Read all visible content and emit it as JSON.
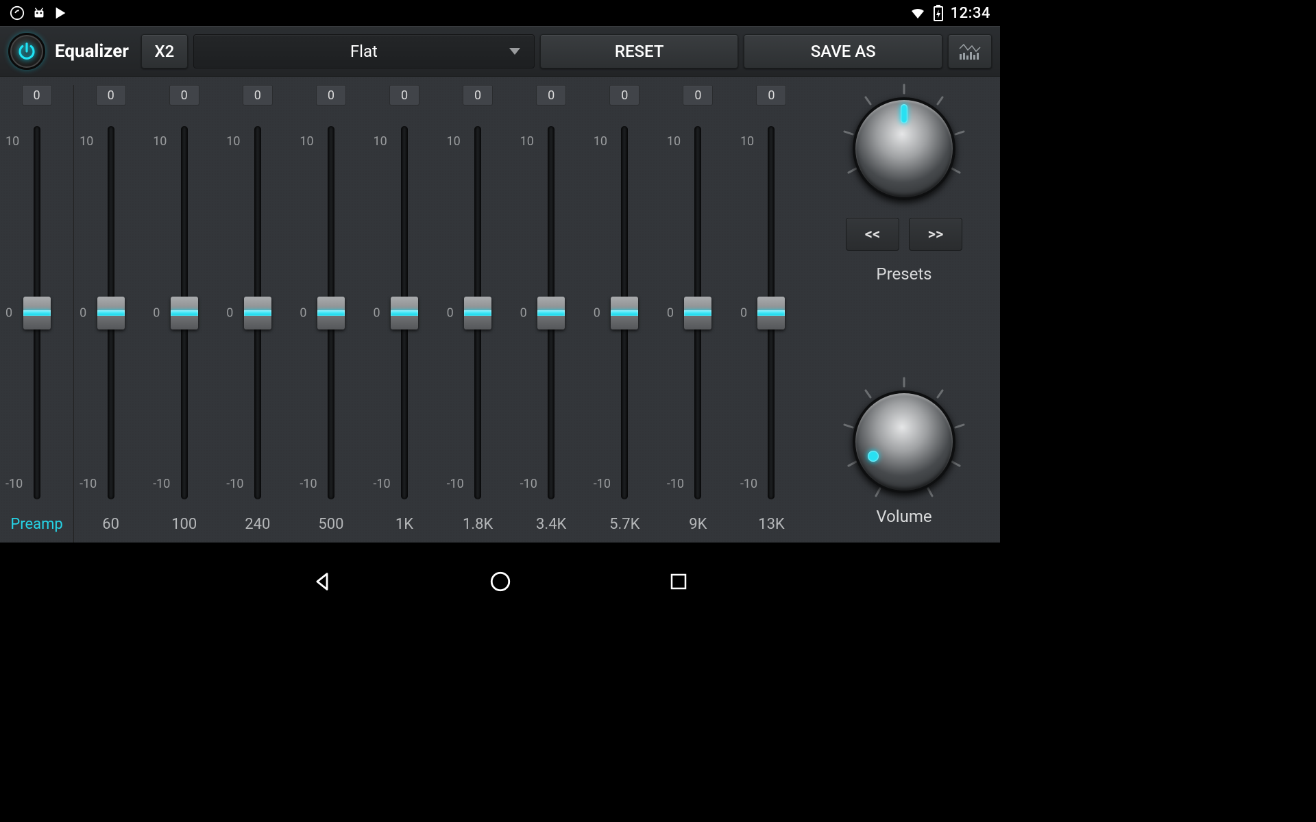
{
  "status": {
    "time": "12:34"
  },
  "toolbar": {
    "title": "Equalizer",
    "x2_label": "X2",
    "preset_selected": "Flat",
    "reset_label": "RESET",
    "saveas_label": "SAVE AS"
  },
  "eq": {
    "scale_max": "10",
    "scale_mid": "0",
    "scale_min": "-10",
    "preamp": {
      "value": "0",
      "label": "Preamp"
    },
    "bands": [
      {
        "value": "0",
        "freq": "60"
      },
      {
        "value": "0",
        "freq": "100"
      },
      {
        "value": "0",
        "freq": "240"
      },
      {
        "value": "0",
        "freq": "500"
      },
      {
        "value": "0",
        "freq": "1K"
      },
      {
        "value": "0",
        "freq": "1.8K"
      },
      {
        "value": "0",
        "freq": "3.4K"
      },
      {
        "value": "0",
        "freq": "5.7K"
      },
      {
        "value": "0",
        "freq": "9K"
      },
      {
        "value": "0",
        "freq": "13K"
      }
    ]
  },
  "side": {
    "presets_label": "Presets",
    "prev_label": "<<",
    "next_label": ">>",
    "volume_label": "Volume"
  }
}
